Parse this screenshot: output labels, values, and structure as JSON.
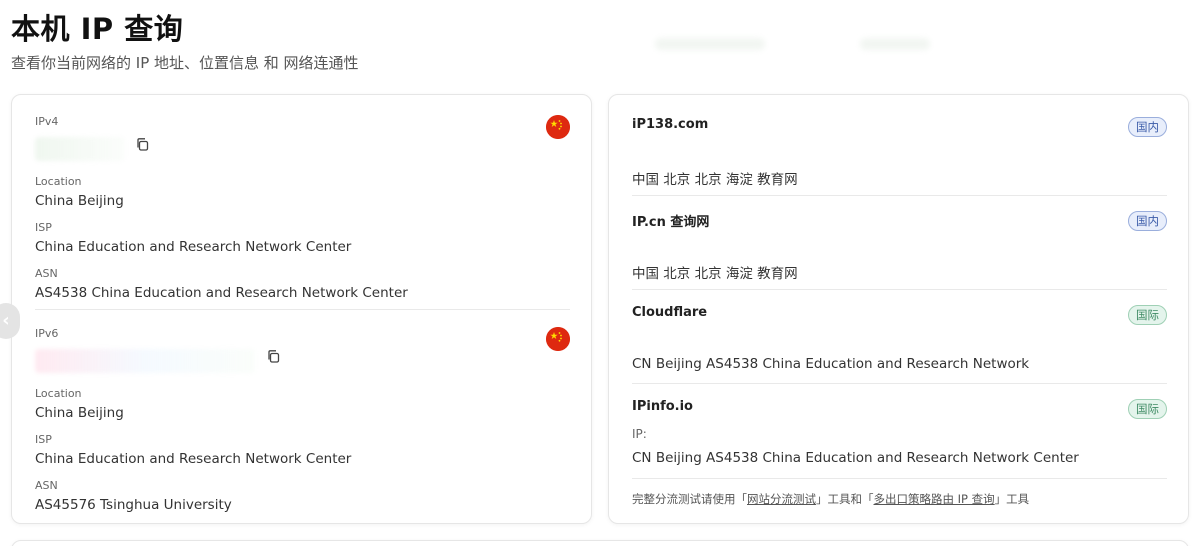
{
  "header": {
    "title": "本机 IP 查询",
    "subtitle": "查看你当前网络的 IP 地址、位置信息 和 网络连通性"
  },
  "local_ip": {
    "ipv4": {
      "label": "IPv4",
      "flag_icon": "china-flag-icon",
      "location_label": "Location",
      "location": "China Beijing",
      "isp_label": "ISP",
      "isp": "China Education and Research Network Center",
      "asn_label": "ASN",
      "asn": "AS4538 China Education and Research Network Center"
    },
    "ipv6": {
      "label": "IPv6",
      "flag_icon": "china-flag-icon",
      "location_label": "Location",
      "location": "China Beijing",
      "isp_label": "ISP",
      "isp": "China Education and Research Network Center",
      "asn_label": "ASN",
      "asn": "AS45576 Tsinghua University"
    }
  },
  "sources": [
    {
      "name": "iP138.com",
      "badge": "国内",
      "badge_type": "domestic",
      "detail": "中国 北京 北京 海淀 教育网"
    },
    {
      "name": "IP.cn 查询网",
      "badge": "国内",
      "badge_type": "domestic",
      "detail": "中国 北京 北京 海淀 教育网"
    },
    {
      "name": "Cloudflare",
      "badge": "国际",
      "badge_type": "international",
      "detail": "CN Beijing AS4538 China Education and Research Network"
    },
    {
      "name": "IPinfo.io",
      "badge": "国际",
      "badge_type": "international",
      "ip_label": "IP:",
      "detail": "CN Beijing AS4538 China Education and Research Network Center"
    }
  ],
  "footnote": {
    "prefix": "完整分流测试请使用「",
    "link1": "网站分流测试",
    "middle": "」工具和「",
    "link2": "多出口策略路由 IP 查询",
    "suffix": "」工具"
  },
  "colors": {
    "flag_red": "#de2910",
    "flag_star": "#ffde00",
    "badge_domestic_bg": "#e8eefb",
    "badge_domestic_text": "#3a5ba8",
    "badge_international_bg": "#e4f4ec",
    "badge_international_text": "#3e8a64"
  }
}
